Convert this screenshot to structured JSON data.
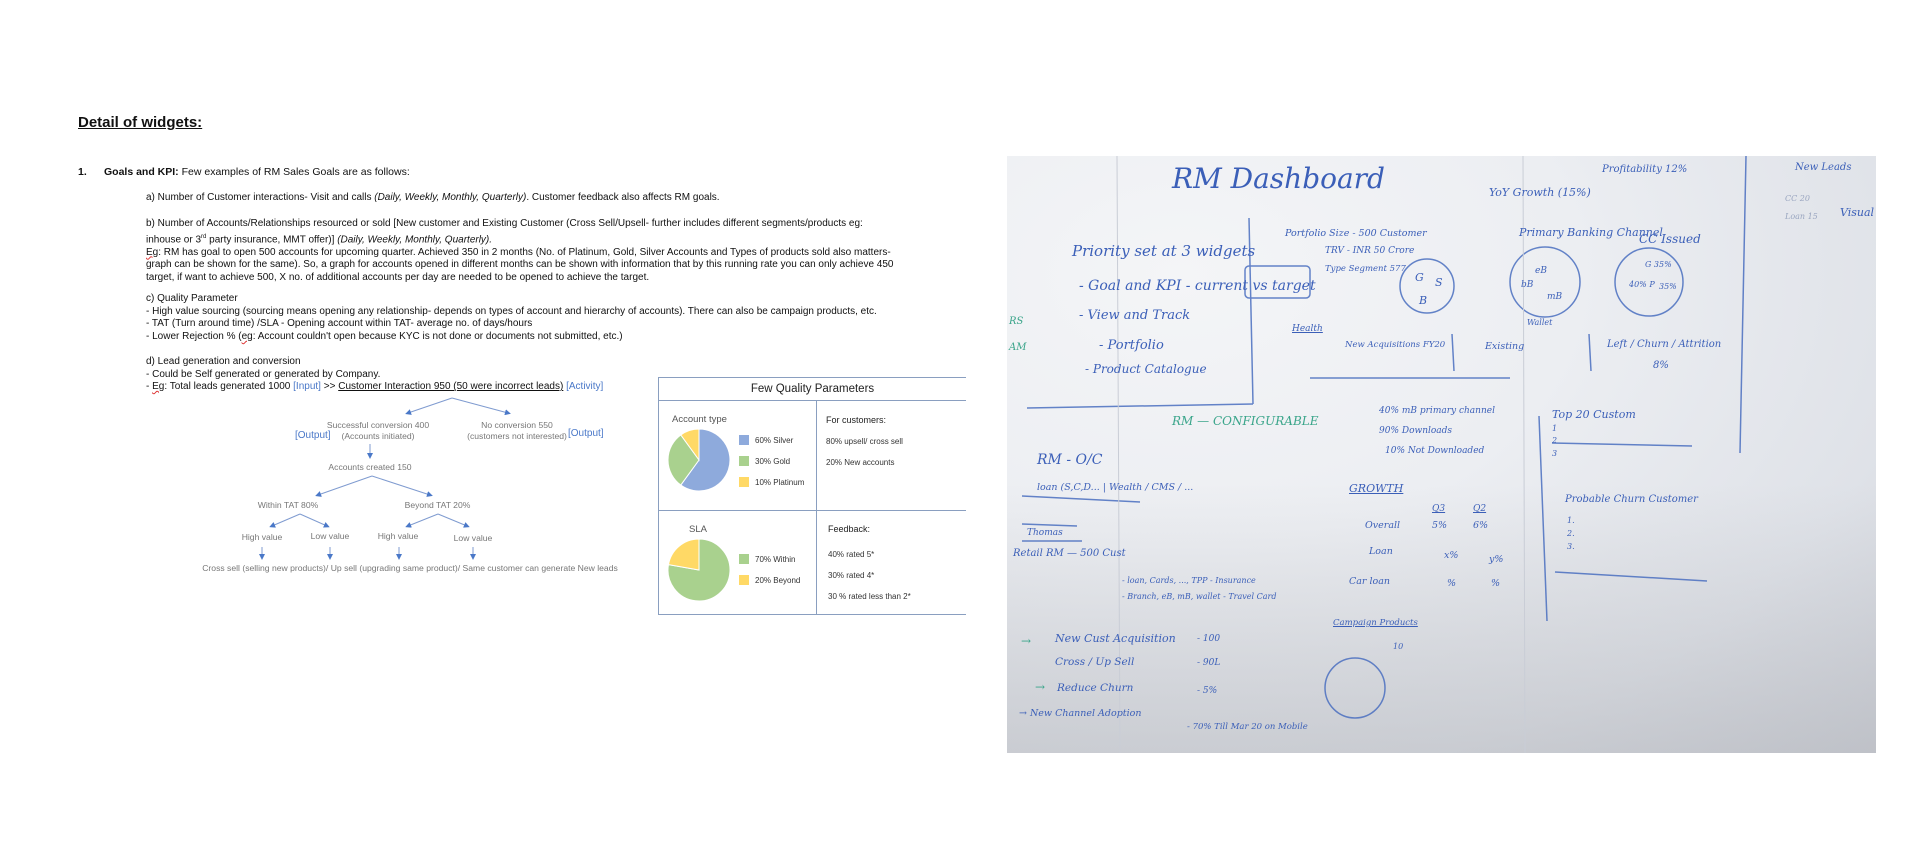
{
  "document": {
    "title": "Detail of widgets:",
    "section": {
      "number": "1.",
      "heading_bold": "Goals and KPI:",
      "heading_rest": " Few examples of RM Sales Goals are as follows:",
      "a": {
        "text": "a) Number of Customer interactions- Visit and calls ",
        "italic": "(Daily, Weekly, Monthly, Quarterly)",
        "tail": ". Customer feedback also affects RM goals."
      },
      "b": {
        "line1": "b) Number of Accounts/Relationships resourced or sold [New customer and Existing Customer (Cross Sell/Upsell- further includes different segments/products eg:",
        "line2_pre": "inhouse or 3",
        "line2_sup": "rd",
        "line2_post": " party insurance, MMT offer)] ",
        "line2_italic": "(Daily, Weekly, Monthly, Quarterly).",
        "eg_label": "Eg",
        "line3": ": RM has goal to open 500 accounts for upcoming quarter. Achieved 350 in 2 months (No. of Platinum, Gold, Silver Accounts and Types of products sold also matters-",
        "line4": "graph can be shown for the same). So, a graph for accounts opened in different months can be shown with information that by this running rate you can only achieve 450",
        "line5": "target, if want to achieve 500, X no. of additional accounts per day are needed to be opened to achieve the target."
      },
      "c": {
        "heading": "c) Quality Parameter",
        "line1": "- High value sourcing (sourcing means opening any relationship- depends on types of account and hierarchy of accounts). There can also be campaign products, etc.",
        "line2": "- TAT (Turn around time) /SLA - Opening account within TAT- average no. of days/hours",
        "line3_pre": "- Lower Rejection % (",
        "line3_eg": "eg",
        "line3_post": ": Account couldn't open because KYC is not done or documents not submitted, etc.)"
      },
      "d": {
        "heading": "d) Lead generation and conversion",
        "line1": "- Could be Self generated or generated by Company.",
        "line2_pre": "- ",
        "line2_eg": "Eg",
        "line2_mid": ": Total leads generated 1000 ",
        "input_tag": "[Input]",
        "arrow": " >> ",
        "interaction": "Customer Interaction 950 (50 were incorrect leads)",
        "activity_tag": " [Activity]"
      }
    },
    "flowchart": {
      "success_line1": "Successful conversion 400",
      "success_line2": "(Accounts initiated)",
      "output_left": "[Output]",
      "noconv_line1": "No conversion 550",
      "noconv_line2": "(customers not interested)",
      "output_right": "[Output]",
      "accounts_created": "Accounts created 150",
      "within_tat": "Within TAT 80%",
      "beyond_tat": "Beyond TAT 20%",
      "high_value_1": "High value",
      "low_value_1": "Low value",
      "high_value_2": "High value",
      "low_value_2": "Low value",
      "footer": "Cross sell (selling new products)/ Up sell (upgrading same product)/ Same customer can generate New leads"
    },
    "quality_panel": {
      "title": "Few Quality Parameters",
      "account_type_label": "Account type",
      "account_legend": [
        "60% Silver",
        "30% Gold",
        "10% Platinum"
      ],
      "customers_heading": "For customers:",
      "customers_items": [
        "80% upsell/ cross sell",
        "20% New accounts"
      ],
      "sla_label": "SLA",
      "sla_legend": [
        "70% Within",
        "20% Beyond"
      ],
      "feedback_heading": "Feedback:",
      "feedback_items": [
        "40% rated 5*",
        "30% rated 4*",
        "30 % rated less than 2*"
      ],
      "colors": {
        "silver": "#8eaadc",
        "gold": "#a9d18e",
        "platinum": "#ffd966"
      }
    }
  },
  "chart_data": [
    {
      "type": "pie",
      "title": "Account type",
      "categories": [
        "Silver",
        "Gold",
        "Platinum"
      ],
      "values": [
        60,
        30,
        10
      ],
      "legend": [
        "60% Silver",
        "30% Gold",
        "10% Platinum"
      ],
      "colors": [
        "#8eaadc",
        "#a9d18e",
        "#ffd966"
      ]
    },
    {
      "type": "pie",
      "title": "SLA",
      "categories": [
        "Within",
        "Beyond"
      ],
      "values": [
        70,
        20
      ],
      "legend": [
        "70% Within",
        "20% Beyond"
      ],
      "colors": [
        "#a9d18e",
        "#ffd966"
      ]
    }
  ],
  "whiteboard": {
    "title": "RM Dashboard",
    "priority_heading": "Priority set at 3 widgets",
    "priority_items": [
      "- Goal and KPI - current vs target",
      "- View and Track",
      "- Portfolio",
      "- Product Catalogue"
    ],
    "side_labels": [
      "RS",
      "AM"
    ],
    "portfolio": [
      "Portfolio Size - 500 Customer",
      "TRV - INR 50 Crore",
      "Type Segment 577"
    ],
    "segment_pie": [
      "G",
      "S",
      "B"
    ],
    "yoy_growth": "YoY Growth (15%)",
    "profitability": "Profitability 12%",
    "primary_banking": "Primary Banking Channel",
    "banking_pie": [
      "eB",
      "bB",
      "mB",
      "Wallet"
    ],
    "cc_issued": "CC Issued",
    "cc_pie": [
      "G 35%",
      "40% P",
      "35%"
    ],
    "new_leads": "New Leads",
    "leads_items": [
      "CC 20",
      "Loan 15"
    ],
    "visual": "Visual",
    "health": "Health",
    "new_acq": "New Acquisitions FY20",
    "existing": "Existing",
    "left_churn": "Left / Churn / Attrition",
    "churn_pct": "8%",
    "configurable": "RM — CONFIGURABLE",
    "rm_oc": "RM - O/C",
    "rm_line": "loan (S,C,D... | Wealth / CMS / ...",
    "thomas": "Thomas",
    "retail_rm": "Retail RM — 500 Cust",
    "retail_sub1": "- loan, Cards, ..., TPP - Insurance",
    "retail_sub2": "- Branch, eB, mB, wallet - Travel Card",
    "channel_stats": [
      "40% mB primary channel",
      "90% Downloads",
      "10% Not Downloaded"
    ],
    "growth": "GROWTH",
    "growth_cols": [
      "Q3",
      "Q2"
    ],
    "growth_rows": [
      {
        "label": "Overall",
        "q3": "5%",
        "q2": "6%"
      },
      {
        "label": "Loan",
        "q3": "x%",
        "q2": "y%"
      },
      {
        "label": "Car loan",
        "q3": "%",
        "q2": "%"
      }
    ],
    "top20": "Top 20 Custom",
    "top20_items": [
      "1",
      "2",
      "3"
    ],
    "probable_churn": "Probable Churn Customer",
    "churn_items": [
      "1.",
      "2.",
      "3."
    ],
    "campaign_products": "Campaign Products",
    "campaign_count": "10",
    "goals": [
      {
        "label": "New Cust Acquisition",
        "value": "- 100"
      },
      {
        "label": "Cross / Up Sell",
        "value": "- 90L"
      },
      {
        "label": "Reduce Churn",
        "value": "- 5%"
      },
      {
        "label": "New Channel Adoption",
        "value": "- 70% Till Mar 20 on Mobile"
      }
    ]
  }
}
